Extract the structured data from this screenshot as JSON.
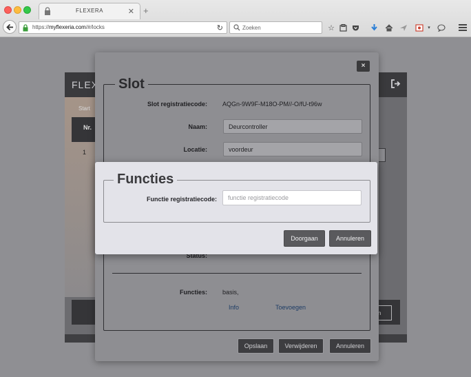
{
  "browser": {
    "tab_title": "FLEXERA",
    "url_prefix": "https://",
    "url_domain": "myflexeria.com",
    "url_path": "/#/locks",
    "search_placeholder": "Zoeken"
  },
  "app": {
    "brand": "FLEX",
    "breadcrumb": "Start",
    "table_header_nr": "Nr.",
    "row_number": "1",
    "partial_col_s": "s",
    "partial_btn_s": "s",
    "partial_btn_gen": "gen"
  },
  "slot_modal": {
    "title": "Slot",
    "close_label": "×",
    "fields": {
      "registratiecode_label": "Slot registratiecode:",
      "registratiecode_value": "AQGn-9W9F-M18O-PM//-O/fU-t96w",
      "naam_label": "Naam:",
      "naam_value": "Deurcontroller",
      "locatie_label": "Locatie:",
      "locatie_value": "voordeur",
      "status_label": "Status:",
      "functies_label": "Functies:",
      "functies_value": "basis,"
    },
    "links": {
      "info": "Info",
      "toevoegen": "Toevoegen"
    },
    "buttons": {
      "opslaan": "Opslaan",
      "verwijderen": "Verwijderen",
      "annuleren": "Annuleren"
    }
  },
  "functies_modal": {
    "title": "Functies",
    "field_label": "Functie registratiecode:",
    "input_placeholder": "functie registratiecode",
    "input_value": "",
    "buttons": {
      "doorgaan": "Doorgaan",
      "annuleren": "Annuleren"
    }
  },
  "colors": {
    "overlay_bg": "#8f8f93",
    "modal_front_bg": "#e3e3e9",
    "button_dark": "#5a5a5d",
    "link": "#1e3d66"
  }
}
